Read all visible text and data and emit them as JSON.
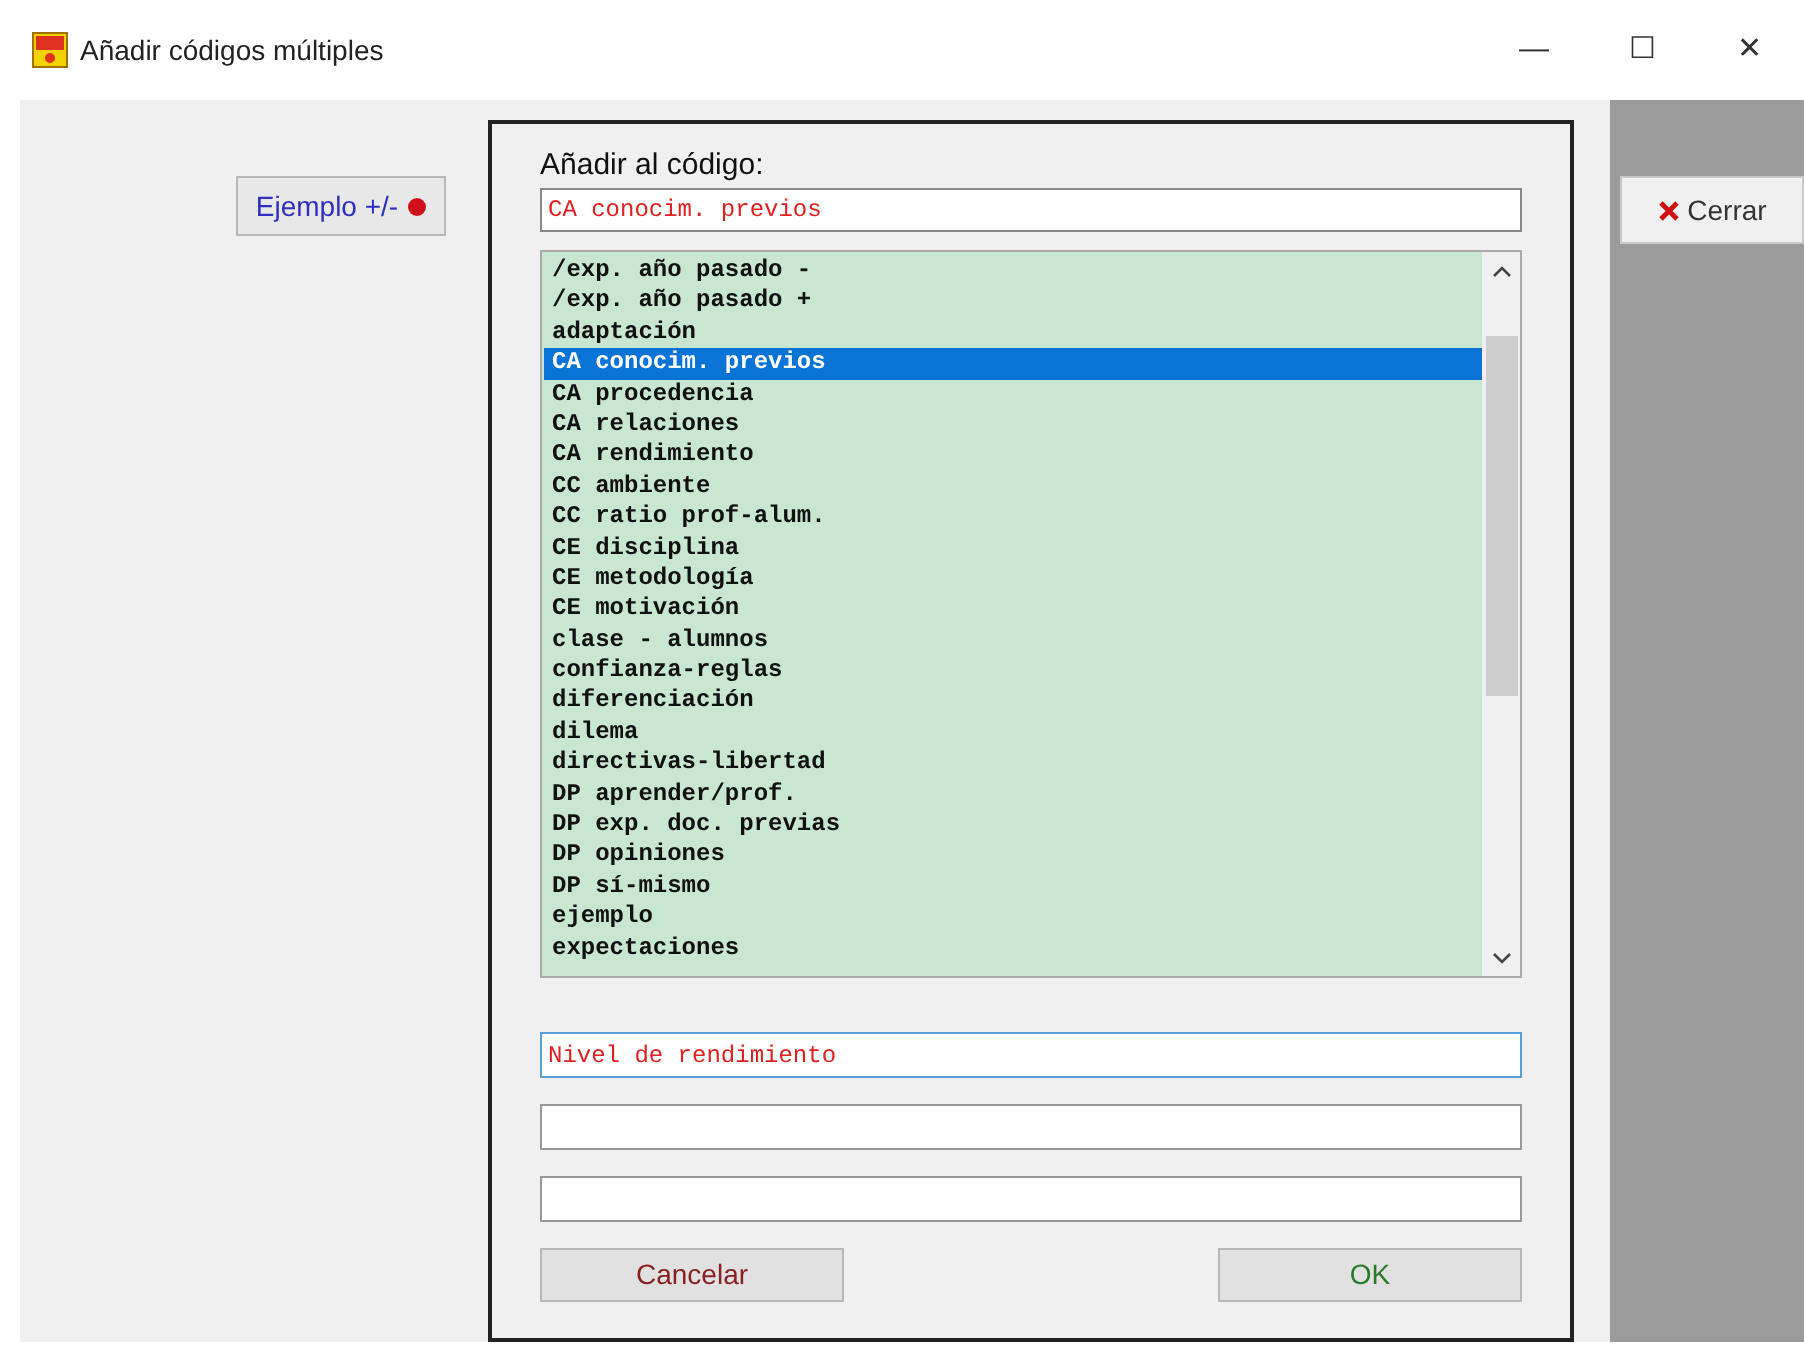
{
  "window": {
    "title": "Añadir códigos múltiples",
    "controls": [
      "—",
      "☐",
      "✕"
    ]
  },
  "example_button": {
    "label": "Ejemplo +/-"
  },
  "close_button": {
    "label": "Cerrar"
  },
  "dialog": {
    "heading": "Añadir al código:",
    "code_value": "CA conocim. previos",
    "codes": [
      {
        "label": "/exp. año pasado -",
        "selected": false
      },
      {
        "label": "/exp. año pasado +",
        "selected": false
      },
      {
        "label": "adaptación",
        "selected": false
      },
      {
        "label": "CA conocim. previos",
        "selected": true
      },
      {
        "label": "CA procedencia",
        "selected": false
      },
      {
        "label": "CA relaciones",
        "selected": false
      },
      {
        "label": "CA rendimiento",
        "selected": false
      },
      {
        "label": "CC ambiente",
        "selected": false
      },
      {
        "label": "CC ratio prof-alum.",
        "selected": false
      },
      {
        "label": "CE disciplina",
        "selected": false
      },
      {
        "label": "CE metodología",
        "selected": false
      },
      {
        "label": "CE motivación",
        "selected": false
      },
      {
        "label": "clase - alumnos",
        "selected": false
      },
      {
        "label": "confianza-reglas",
        "selected": false
      },
      {
        "label": "diferenciación",
        "selected": false
      },
      {
        "label": "dilema",
        "selected": false
      },
      {
        "label": "directivas-libertad",
        "selected": false
      },
      {
        "label": "DP aprender/prof.",
        "selected": false
      },
      {
        "label": "DP exp. doc. previas",
        "selected": false
      },
      {
        "label": "DP opiniones",
        "selected": false
      },
      {
        "label": "DP sí-mismo",
        "selected": false
      },
      {
        "label": "ejemplo",
        "selected": false
      },
      {
        "label": "expectaciones",
        "selected": false
      }
    ],
    "new_codes": [
      {
        "value": "Nivel de rendimiento",
        "focused": true
      },
      {
        "focused": false
      },
      {
        "focused": false
      }
    ],
    "cancel_button": {
      "label": "Cancelar"
    },
    "ok_button": {
      "label": "OK"
    }
  }
}
